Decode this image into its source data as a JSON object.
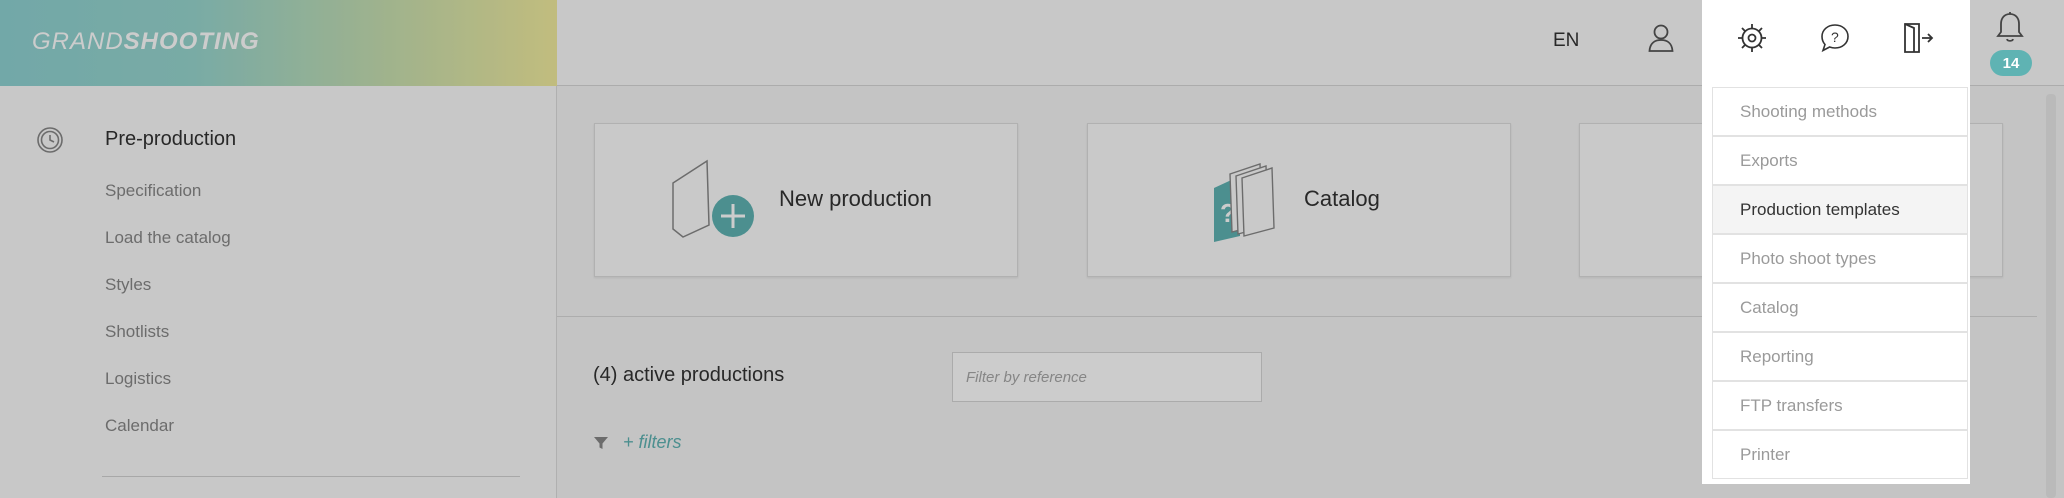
{
  "header": {
    "logo_light": "GRAND",
    "logo_bold": "SHOOTING",
    "language": "EN",
    "icons": [
      "user-icon",
      "settings-gear-icon",
      "help-icon",
      "logout-door-icon",
      "bell-icon"
    ],
    "notification_count": "14"
  },
  "sidebar": {
    "section_title": "Pre-production",
    "items": [
      {
        "label": "Specification"
      },
      {
        "label": "Load the catalog"
      },
      {
        "label": "Styles"
      },
      {
        "label": "Shotlists"
      },
      {
        "label": "Logistics"
      },
      {
        "label": "Calendar"
      }
    ]
  },
  "main": {
    "cards": [
      {
        "label": "New production",
        "icon": "new-production-icon"
      },
      {
        "label": "Catalog",
        "icon": "catalog-icon"
      }
    ],
    "active_productions_label": "(4) active productions",
    "filter_placeholder": "Filter by reference",
    "filters_link": "+ filters"
  },
  "settings_menu": {
    "items": [
      {
        "label": "Shooting methods"
      },
      {
        "label": "Exports"
      },
      {
        "label": "Production templates",
        "selected": true
      },
      {
        "label": "Photo shoot types"
      },
      {
        "label": "Catalog"
      },
      {
        "label": "Reporting"
      },
      {
        "label": "FTP transfers"
      },
      {
        "label": "Printer"
      }
    ]
  },
  "colors": {
    "accent": "#5fb3b3",
    "logo_gradient_start": "#8fd3d2",
    "logo_gradient_end": "#f2ec9e"
  }
}
